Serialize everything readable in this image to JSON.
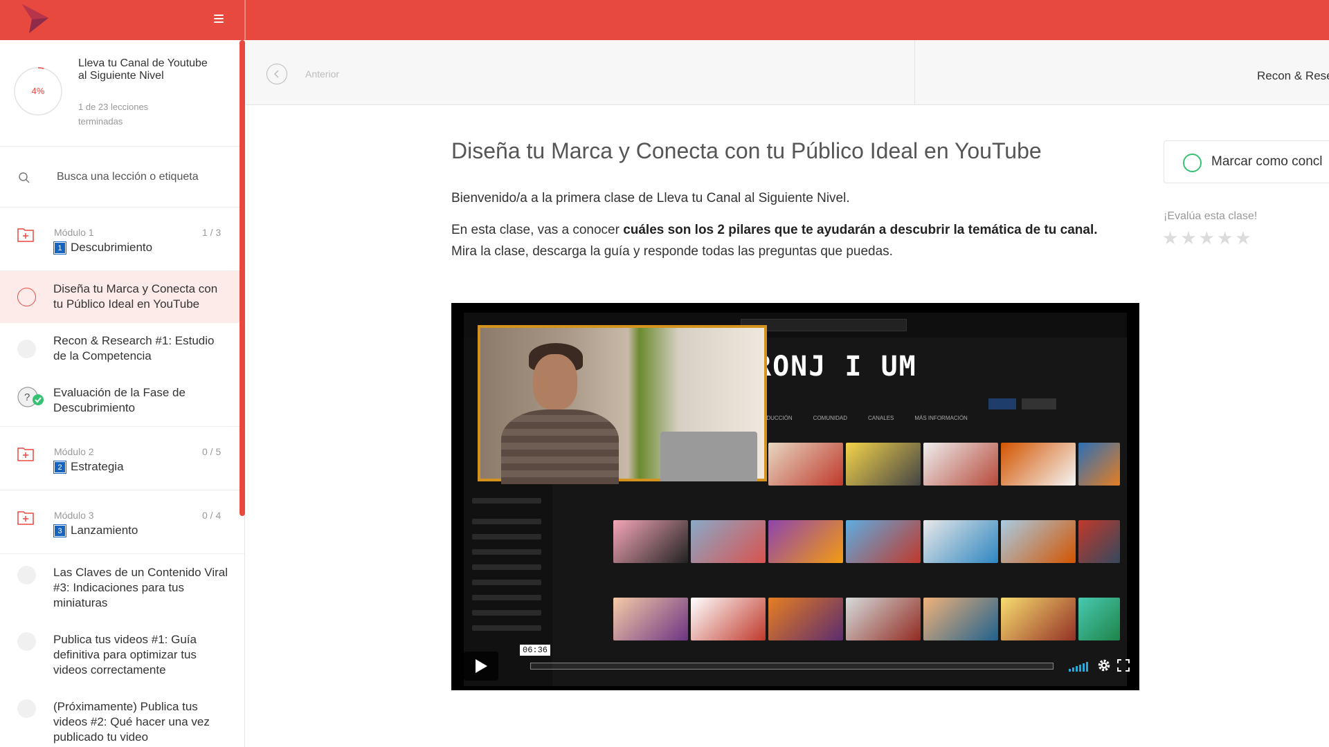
{
  "course": {
    "progress_percent": "4%",
    "title": "Lleva tu Canal de Youtube al Siguiente Nivel",
    "progress_text": "1 de 23 lecciones terminadas"
  },
  "search": {
    "placeholder": "Busca una lección o etiqueta"
  },
  "modules": [
    {
      "label": "Módulo 1",
      "count": "1 / 3",
      "number": "1",
      "name": "Descubrimiento"
    },
    {
      "label": "Módulo 2",
      "count": "0 / 5",
      "number": "2",
      "name": "Estrategia"
    },
    {
      "label": "Módulo 3",
      "count": "0 / 4",
      "number": "3",
      "name": "Lanzamiento"
    }
  ],
  "lessons": {
    "m1": [
      {
        "title": "Diseña tu Marca y Conecta con tu Público Ideal en YouTube"
      },
      {
        "title": "Recon & Research #1: Estudio de la Competencia"
      },
      {
        "title": "Evaluación de la Fase de Descubrimiento"
      }
    ],
    "m3": [
      {
        "title": "Las Claves de un Contenido Viral #3: Indicaciones para tus miniaturas"
      },
      {
        "title": "Publica tus videos #1: Guía definitiva para optimizar tus videos correctamente"
      },
      {
        "title": "(Próximamente) Publica tus videos #2: Qué hacer una vez publicado tu video"
      }
    ]
  },
  "nav": {
    "prev_label": "Anterior",
    "next_label": "Recon & Rese"
  },
  "main": {
    "title": "Diseña tu Marca y Conecta con tu Público Ideal en YouTube",
    "para1": "Bienvenido/a a la primera clase de Lleva tu Canal al Siguiente Nivel.",
    "para2_prefix": "En esta clase, vas a conocer ",
    "para2_bold": "cuáles son los 2 pilares que te ayudarán a descubrir la temática de tu canal.",
    "para2_suffix": "Mira la clase, descarga la guía y responde todas las preguntas que puedas."
  },
  "sidebar_right": {
    "mark_label": "Marcar como concl",
    "rate_label": "¡Evalúa esta clase!",
    "stars": 5
  },
  "video": {
    "time": "06:36",
    "banner_text": "RONJ I UM",
    "tabs": [
      "PRODUCCIÓN",
      "COMUNIDAD",
      "CANALES",
      "MÁS INFORMACIÓN"
    ]
  },
  "colors": {
    "brand": "#e8493f",
    "complete_green": "#38c172",
    "module_badge": "#1565c0"
  }
}
